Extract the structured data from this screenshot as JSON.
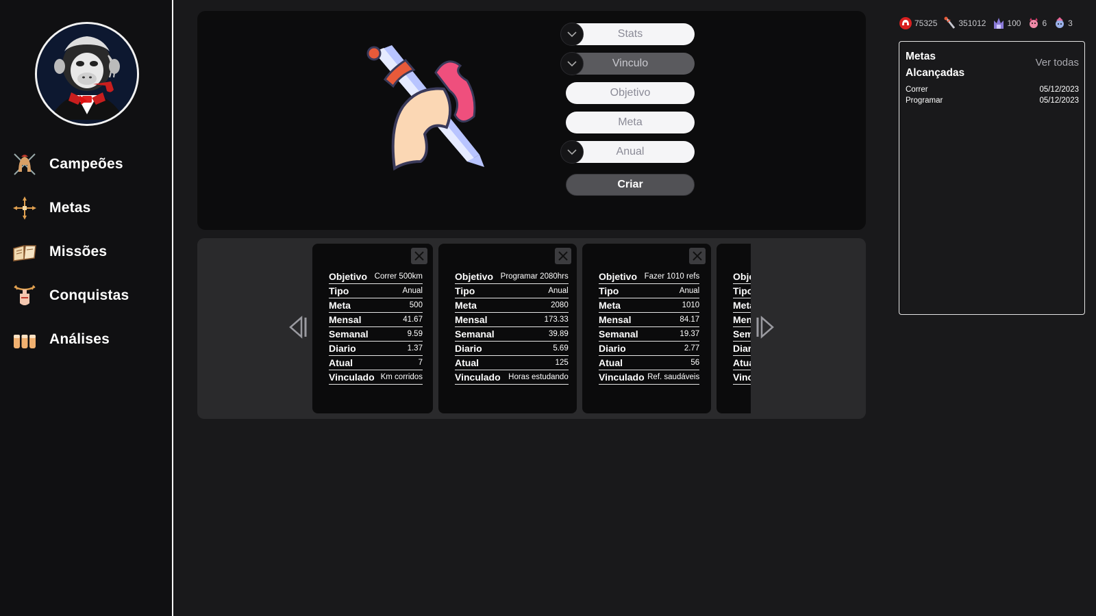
{
  "sidebar": {
    "items": [
      {
        "label": "Campeões",
        "icon": "spartan-helmet-icon"
      },
      {
        "label": "Metas",
        "icon": "crosshair-target-icon"
      },
      {
        "label": "Missões",
        "icon": "open-book-icon"
      },
      {
        "label": "Conquistas",
        "icon": "trophy-fist-icon"
      },
      {
        "label": "Análises",
        "icon": "bar-chart-icon"
      }
    ]
  },
  "form": {
    "fields": [
      {
        "label": "Stats",
        "dropdown": true
      },
      {
        "label": "Vinculo",
        "dropdown": true
      },
      {
        "label": "Objetivo",
        "dropdown": false
      },
      {
        "label": "Meta",
        "dropdown": false
      },
      {
        "label": "Anual",
        "dropdown": true
      }
    ],
    "submit_label": "Criar"
  },
  "cards": [
    {
      "objetivo": "Correr 500km",
      "tipo": "Anual",
      "meta": "500",
      "mensal": "41.67",
      "semanal": "9.59",
      "diario": "1.37",
      "atual": "7",
      "vinculado": "Km corridos"
    },
    {
      "objetivo": "Programar 2080hrs",
      "tipo": "Anual",
      "meta": "2080",
      "mensal": "173.33",
      "semanal": "39.89",
      "diario": "5.69",
      "atual": "125",
      "vinculado": "Horas estudando"
    },
    {
      "objetivo": "Fazer 1010 refs",
      "tipo": "Anual",
      "meta": "1010",
      "mensal": "84.17",
      "semanal": "19.37",
      "diario": "2.77",
      "atual": "56",
      "vinculado": "Ref. saudáveis"
    },
    {
      "objetivo": "",
      "tipo": "",
      "meta": "",
      "mensal": "",
      "semanal": "",
      "diario": "",
      "atual": "",
      "vinculado": ""
    }
  ],
  "card_keys": {
    "objetivo": "Objetivo",
    "tipo": "Tipo",
    "meta": "Meta",
    "mensal": "Mensal",
    "semanal": "Semanal",
    "diario": "Diario",
    "atual": "Atual",
    "vinculado": "Vinculado"
  },
  "stats": [
    {
      "value": "75325",
      "icon": "red-helmet-icon"
    },
    {
      "value": "351012",
      "icon": "sword-icon"
    },
    {
      "value": "100",
      "icon": "purple-crown-icon"
    },
    {
      "value": "6",
      "icon": "pink-demon-icon"
    },
    {
      "value": "3",
      "icon": "blue-creature-icon"
    }
  ],
  "achieved": {
    "title_line1": "Metas",
    "title_line2": "Alcançadas",
    "see_all": "Ver todas",
    "rows": [
      {
        "name": "Correr",
        "date": "05/12/2023"
      },
      {
        "name": "Programar",
        "date": "05/12/2023"
      }
    ]
  }
}
